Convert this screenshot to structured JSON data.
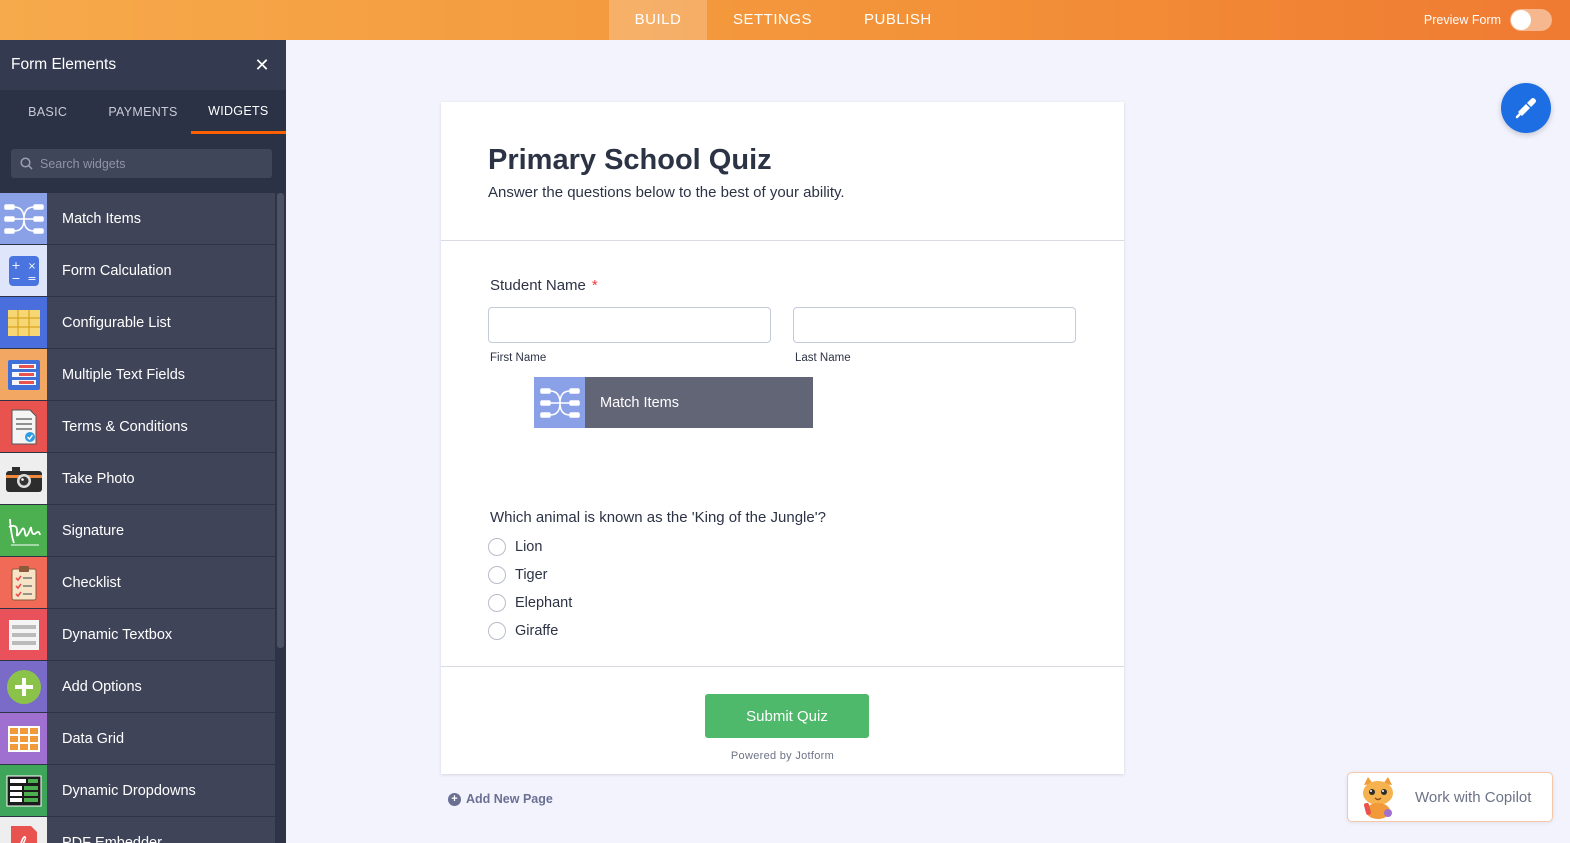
{
  "topbar": {
    "tabs": [
      {
        "label": "BUILD",
        "active": true
      },
      {
        "label": "SETTINGS",
        "active": false
      },
      {
        "label": "PUBLISH",
        "active": false
      }
    ],
    "preview_label": "Preview Form",
    "preview_enabled": false
  },
  "sidebar": {
    "title": "Form Elements",
    "tabs": [
      {
        "label": "BASIC",
        "active": false
      },
      {
        "label": "PAYMENTS",
        "active": false
      },
      {
        "label": "WIDGETS",
        "active": true
      }
    ],
    "search_placeholder": "Search widgets",
    "items": [
      {
        "label": "Match Items",
        "icon": "match-items-icon",
        "color": "#8aa1e8"
      },
      {
        "label": "Form Calculation",
        "icon": "calculator-icon",
        "color": "#6a8fe8"
      },
      {
        "label": "Configurable List",
        "icon": "configurable-list-icon",
        "color": "#4a6fdc"
      },
      {
        "label": "Multiple Text Fields",
        "icon": "multiple-text-fields-icon",
        "color": "#f2a863"
      },
      {
        "label": "Terms & Conditions",
        "icon": "terms-document-icon",
        "color": "#e8524f"
      },
      {
        "label": "Take Photo",
        "icon": "camera-icon",
        "color": "#eeeeee"
      },
      {
        "label": "Signature",
        "icon": "signature-icon",
        "color": "#4caf50"
      },
      {
        "label": "Checklist",
        "icon": "checklist-icon",
        "color": "#f06a57"
      },
      {
        "label": "Dynamic Textbox",
        "icon": "dynamic-textbox-icon",
        "color": "#e9525a"
      },
      {
        "label": "Add Options",
        "icon": "add-options-icon",
        "color": "#7b6bc8"
      },
      {
        "label": "Data Grid",
        "icon": "data-grid-icon",
        "color": "#a070d0"
      },
      {
        "label": "Dynamic Dropdowns",
        "icon": "dynamic-dropdowns-icon",
        "color": "#3fa55b"
      },
      {
        "label": "PDF Embedder",
        "icon": "pdf-icon",
        "color": "#e8524f"
      }
    ]
  },
  "form": {
    "title": "Primary School Quiz",
    "subtitle": "Answer the questions below to the best of your ability.",
    "student_name_label": "Student Name",
    "required_mark": "*",
    "first_name_sublabel": "First Name",
    "last_name_sublabel": "Last Name",
    "first_name_value": "",
    "last_name_value": "",
    "dragging_widget_label": "Match Items",
    "question": "Which animal is known as the 'King of the Jungle'?",
    "options": [
      "Lion",
      "Tiger",
      "Elephant",
      "Giraffe"
    ],
    "submit_label": "Submit Quiz",
    "powered_by": "Powered by Jotform"
  },
  "add_page_label": "Add New Page",
  "copilot_label": "Work with Copilot",
  "colors": {
    "topbar_start": "#f6aa4b",
    "topbar_end": "#ef7a32",
    "sidebar_bg": "#343a4f",
    "active_tab_underline": "#ff6100",
    "submit_button": "#4fb96b",
    "fab": "#1d6ee2",
    "canvas_bg": "#f3f3fe"
  }
}
